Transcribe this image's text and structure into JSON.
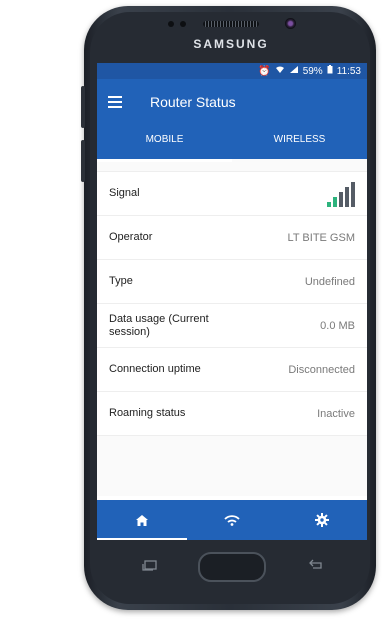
{
  "device": {
    "brand": "SAMSUNG"
  },
  "status_bar": {
    "battery": "59%",
    "time": "11:53"
  },
  "app_bar": {
    "title": "Router Status"
  },
  "tabs": [
    {
      "label": "MOBILE",
      "active": true
    },
    {
      "label": "WIRELESS",
      "active": false
    }
  ],
  "rows": [
    {
      "label": "Signal",
      "value": ""
    },
    {
      "label": "Operator",
      "value": "LT BITE GSM"
    },
    {
      "label": "Type",
      "value": "Undefined"
    },
    {
      "label": "Data usage (Current session)",
      "value": "0.0 MB"
    },
    {
      "label": "Connection uptime",
      "value": "Disconnected"
    },
    {
      "label": "Roaming status",
      "value": "Inactive"
    }
  ],
  "signal": {
    "bars_total": 5,
    "bars_filled": 2,
    "filled_color": "#2db37d",
    "empty_color": "#555c66"
  },
  "bottom_nav": [
    {
      "icon": "home-icon",
      "active": true
    },
    {
      "icon": "wifi-icon",
      "active": false
    },
    {
      "icon": "gear-icon",
      "active": false
    }
  ],
  "colors": {
    "primary": "#2162b8",
    "status_bar": "#1f56a4"
  }
}
